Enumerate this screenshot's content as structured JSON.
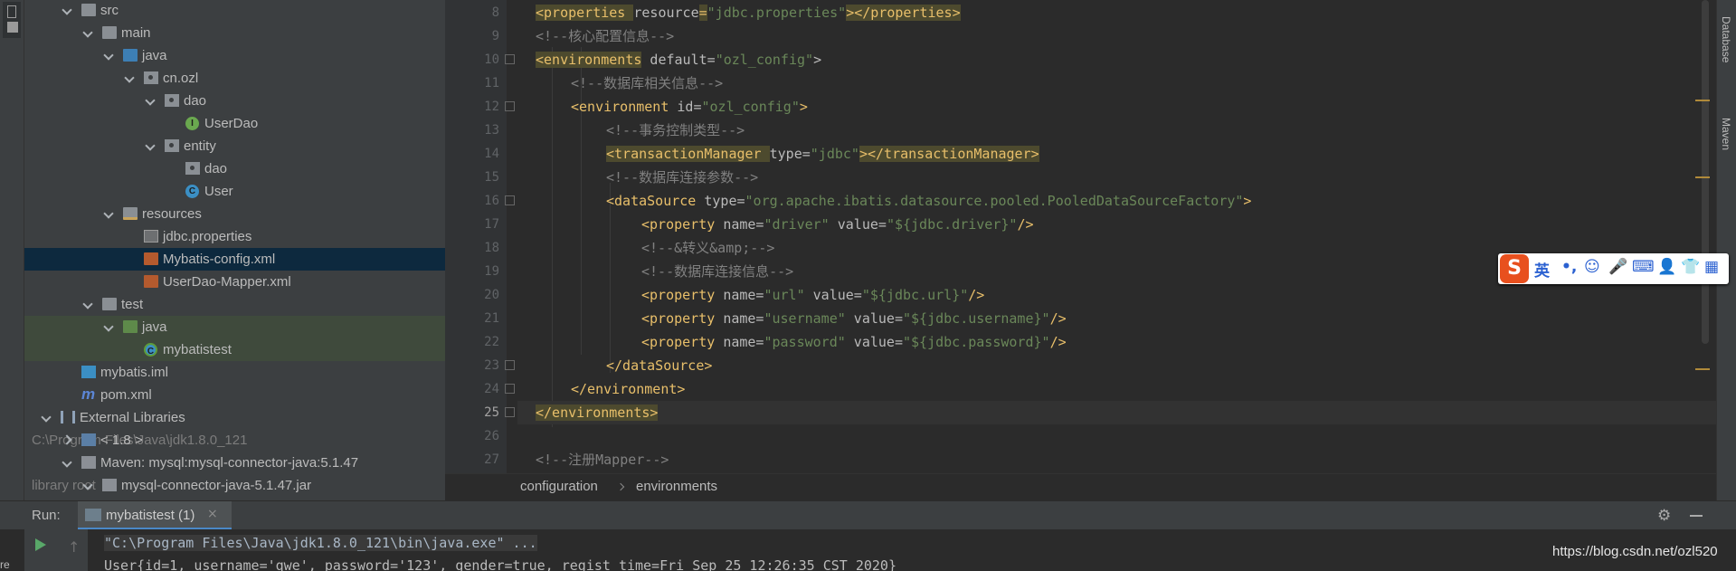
{
  "project_tree": [
    {
      "label": "src",
      "icon": "folder-icon",
      "indent": 1,
      "expanded": true
    },
    {
      "label": "main",
      "icon": "folder-icon",
      "indent": 2,
      "expanded": true
    },
    {
      "label": "java",
      "icon": "source-folder-icon",
      "indent": 3,
      "expanded": true
    },
    {
      "label": "cn.ozl",
      "icon": "package-icon",
      "indent": 4,
      "expanded": true
    },
    {
      "label": "dao",
      "icon": "package-icon",
      "indent": 5,
      "expanded": true
    },
    {
      "label": "UserDao",
      "icon": "interface-icon",
      "indent": 6
    },
    {
      "label": "entity",
      "icon": "package-icon",
      "indent": 5,
      "expanded": true
    },
    {
      "label": "dao",
      "icon": "package-icon",
      "indent": 6
    },
    {
      "label": "User",
      "icon": "class-icon",
      "indent": 6
    },
    {
      "label": "resources",
      "icon": "resources-folder-icon",
      "indent": 3,
      "expanded": true
    },
    {
      "label": "jdbc.properties",
      "icon": "properties-file-icon",
      "indent": 4
    },
    {
      "label": "Mybatis-config.xml",
      "icon": "xml-file-icon",
      "indent": 4,
      "selected": true
    },
    {
      "label": "UserDao-Mapper.xml",
      "icon": "xml-file-icon",
      "indent": 4
    },
    {
      "label": "test",
      "icon": "folder-icon",
      "indent": 2,
      "expanded": true
    },
    {
      "label": "java",
      "icon": "test-folder-icon",
      "indent": 3,
      "expanded": true,
      "tested": true
    },
    {
      "label": "mybatistest",
      "icon": "test-class-icon",
      "indent": 4,
      "tested": true
    },
    {
      "label": "mybatis.iml",
      "icon": "iml-file-icon",
      "indent": 1
    },
    {
      "label": "pom.xml",
      "icon": "maven-pom-icon",
      "indent": 1
    },
    {
      "label": "External Libraries",
      "icon": "libraries-icon",
      "indent": 0,
      "expanded": true
    },
    {
      "label": "< 1.8 >",
      "extra": "C:\\Program Files\\Java\\jdk1.8.0_121",
      "icon": "jdk-icon",
      "indent": 1,
      "collapsed": true
    },
    {
      "label": "Maven: mysql:mysql-connector-java:5.1.47",
      "icon": "maven-library-icon",
      "indent": 1,
      "expanded": true
    },
    {
      "label": "mysql-connector-java-5.1.47.jar",
      "extra": "library root",
      "icon": "jar-icon",
      "indent": 2,
      "expanded": true
    }
  ],
  "editor": {
    "line_numbers": [
      "8",
      "9",
      "10",
      "11",
      "12",
      "13",
      "14",
      "15",
      "16",
      "17",
      "18",
      "19",
      "20",
      "21",
      "22",
      "23",
      "24",
      "25",
      "26",
      "27"
    ],
    "current_line": "25",
    "lines": [
      [
        {
          "t": "tag",
          "s": "<properties "
        },
        {
          "t": "attr",
          "s": "resource"
        },
        {
          "t": "tag",
          "s": "="
        },
        {
          "t": "val",
          "s": "\"jdbc.properties\""
        },
        {
          "t": "tag",
          "s": "></properties>"
        }
      ],
      [
        {
          "t": "comment",
          "s": "<!--核心配置信息-->"
        }
      ],
      [
        {
          "t": "tag",
          "s": "<environments"
        },
        {
          "t": "attr",
          "s": " default="
        },
        {
          "t": "val",
          "s": "\"ozl_config\""
        },
        {
          "t": "attr",
          "s": ">"
        }
      ],
      [
        {
          "t": "comment",
          "s": "<!--数据库相关信息-->"
        }
      ],
      [
        {
          "t": "tag",
          "s": "<environment "
        },
        {
          "t": "attr",
          "s": "id="
        },
        {
          "t": "val",
          "s": "\"ozl_config\""
        },
        {
          "t": "tag",
          "s": ">"
        }
      ],
      [
        {
          "t": "comment",
          "s": "<!--事务控制类型-->"
        }
      ],
      [
        {
          "t": "tag",
          "s": "<transactionManager "
        },
        {
          "t": "attr",
          "s": "type="
        },
        {
          "t": "val",
          "s": "\"jdbc\""
        },
        {
          "t": "tag",
          "s": "></transactionManager>"
        }
      ],
      [
        {
          "t": "comment",
          "s": "<!--数据库连接参数-->"
        }
      ],
      [
        {
          "t": "tag",
          "s": "<dataSource "
        },
        {
          "t": "attr",
          "s": "type="
        },
        {
          "t": "val",
          "s": "\"org.apache.ibatis.datasource.pooled.PooledDataSourceFactory\""
        },
        {
          "t": "tag",
          "s": ">"
        }
      ],
      [
        {
          "t": "tag",
          "s": "<property "
        },
        {
          "t": "attr",
          "s": "name="
        },
        {
          "t": "val",
          "s": "\"driver\""
        },
        {
          "t": "attr",
          "s": " value="
        },
        {
          "t": "val",
          "s": "\"${jdbc.driver}\""
        },
        {
          "t": "tag",
          "s": "/>"
        }
      ],
      [
        {
          "t": "comment",
          "s": "<!--&转义&amp;-->"
        }
      ],
      [
        {
          "t": "comment",
          "s": "<!--数据库连接信息-->"
        }
      ],
      [
        {
          "t": "tag",
          "s": "<property "
        },
        {
          "t": "attr",
          "s": "name="
        },
        {
          "t": "val",
          "s": "\"url\""
        },
        {
          "t": "attr",
          "s": " value="
        },
        {
          "t": "val",
          "s": "\"${jdbc.url}\""
        },
        {
          "t": "tag",
          "s": "/>"
        }
      ],
      [
        {
          "t": "tag",
          "s": "<property "
        },
        {
          "t": "attr",
          "s": "name="
        },
        {
          "t": "val",
          "s": "\"username\""
        },
        {
          "t": "attr",
          "s": " value="
        },
        {
          "t": "val",
          "s": "\"${jdbc.username}\""
        },
        {
          "t": "tag",
          "s": "/>"
        }
      ],
      [
        {
          "t": "tag",
          "s": "<property "
        },
        {
          "t": "attr",
          "s": "name="
        },
        {
          "t": "val",
          "s": "\"password\""
        },
        {
          "t": "attr",
          "s": " value="
        },
        {
          "t": "val",
          "s": "\"${jdbc.password}\""
        },
        {
          "t": "tag",
          "s": "/>"
        }
      ],
      [
        {
          "t": "tag",
          "s": "</dataSource>"
        }
      ],
      [
        {
          "t": "tag",
          "s": "</environment>"
        }
      ],
      [
        {
          "t": "tag",
          "s": "</environments>"
        }
      ],
      [],
      [
        {
          "t": "comment",
          "s": "<!--注册Mapper-->"
        }
      ]
    ]
  },
  "breadcrumb": [
    "configuration",
    "environments"
  ],
  "right_sidebar": {
    "database": "Database",
    "maven": "Maven"
  },
  "ime": {
    "logo": "S",
    "mode": "英",
    "items": [
      "•,",
      "☺",
      "🎤",
      "⌨",
      "👤",
      "👕",
      "▦"
    ]
  },
  "run_panel": {
    "label": "Run:",
    "tab_name": "mybatistest (1)",
    "close": "×",
    "console": [
      "\"C:\\Program Files\\Java\\jdk1.8.0_121\\bin\\java.exe\" ...",
      "User{id=1, username='qwe', password='123', gender=true, regist_time=Fri Sep 25 12:26:35 CST 2020}"
    ]
  },
  "left_bottom_label": "re",
  "watermark": "https://blog.csdn.net/ozl520",
  "colors": {
    "tag": "#e8bf6a",
    "attr": "#bababa",
    "value": "#6a8759",
    "comment": "#808080",
    "selection": "#0d293e"
  }
}
